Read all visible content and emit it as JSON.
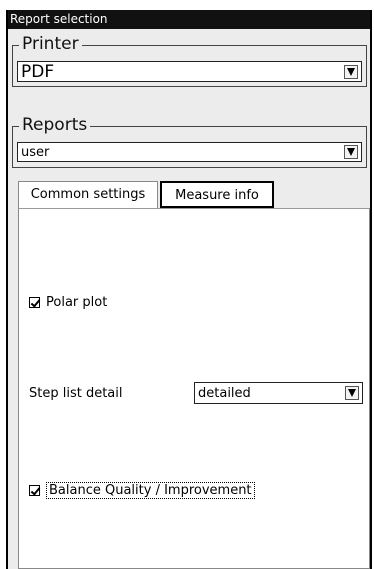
{
  "window": {
    "title": "Report selection"
  },
  "printer": {
    "label": "Printer",
    "selected": "PDF"
  },
  "reports": {
    "label": "Reports",
    "selected": "user"
  },
  "tabs": [
    {
      "label": "Common settings",
      "active": false
    },
    {
      "label": "Measure info",
      "active": true
    }
  ],
  "measure_info": {
    "polar_plot": {
      "label": "Polar plot",
      "checked": true
    },
    "step_list_detail": {
      "label": "Step list detail",
      "selected": "detailed"
    },
    "balance_quality": {
      "label": "Balance Quality / Improvement",
      "checked": true
    }
  }
}
